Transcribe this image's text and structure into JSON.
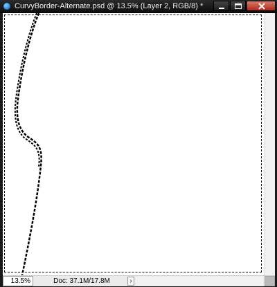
{
  "window": {
    "title": "CurvyBorder-Alternate.psd @ 13.5% (Layer 2, RGB/8) *"
  },
  "window_buttons": {
    "minimize": "minimize-icon",
    "maximize": "maximize-icon",
    "close": "close-icon"
  },
  "app_icon": "photoshop-icon",
  "statusbar": {
    "zoom": "13.5%",
    "doc_info": "Doc: 37.1M/17.8M",
    "arrow": "›"
  },
  "colors": {
    "titlebar": "#1a1a1a",
    "canvas": "#ffffff",
    "close_button": "#c0392b",
    "selection": "#000000"
  }
}
